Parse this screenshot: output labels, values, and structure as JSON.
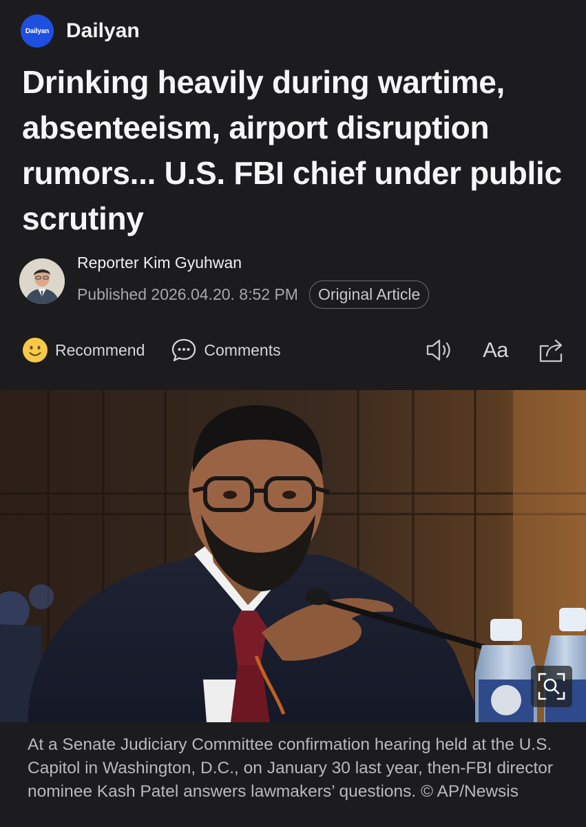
{
  "publisher": {
    "logo_text": "Dailyan",
    "name": "Dailyan",
    "logo_color": "#1f4fe0"
  },
  "article": {
    "headline": "Drinking heavily during wartime, absenteeism, airport disruption rumors... U.S. FBI chief under public scrutiny",
    "reporter": "Reporter Kim Gyuhwan",
    "published": "Published 2026.04.20. 8:52 PM",
    "original_article_label": "Original Article"
  },
  "actions": {
    "recommend_label": "Recommend",
    "comments_label": "Comments",
    "font_size_label": "Aa",
    "icons": [
      "smiley-icon",
      "speech-bubble-icon",
      "speaker-icon",
      "share-icon"
    ]
  },
  "photo": {
    "zoom_icon": "magnify-expand-icon",
    "caption": "At a Senate Judiciary Committee confirmation hearing held at the U.S. Capitol in Washington, D.C., on January 30 last year, then-FBI director nominee Kash Patel answers lawmakers’ questions. © AP/Newsis"
  },
  "colors": {
    "background": "#1c1c1e",
    "text_primary": "#f7f7f7",
    "text_secondary": "#a8a8ad",
    "accent_yellow": "#f7c948"
  }
}
